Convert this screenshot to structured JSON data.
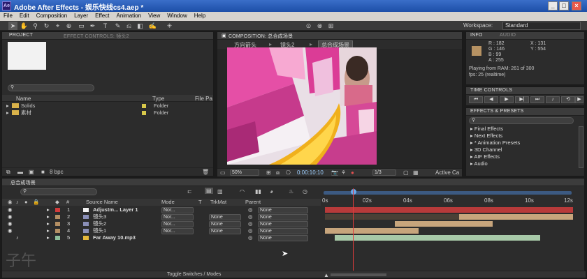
{
  "window": {
    "title": "Adobe After Effects - 娱乐快线cs4.aep *",
    "app_icon": "Ae"
  },
  "menu": [
    "File",
    "Edit",
    "Composition",
    "Layer",
    "Effect",
    "Animation",
    "View",
    "Window",
    "Help"
  ],
  "toolbar": {
    "workspace_label": "Workspace:",
    "workspace_value": "Standard"
  },
  "project": {
    "tabs": [
      "PROJECT",
      "EFFECT CONTROLS: 镜头2"
    ],
    "columns": {
      "name": "Name",
      "type": "Type",
      "filepath": "File Pa"
    },
    "items": [
      {
        "name": "Solids",
        "type": "Folder"
      },
      {
        "name": "素材",
        "type": "Folder"
      }
    ],
    "bpc": "8 bpc"
  },
  "composition": {
    "tab": "COMPOSITION: 总合成场景",
    "breadcrumbs": [
      "方向箭头",
      "镜头2",
      "总合成场景"
    ],
    "zoom": "50%",
    "timecode": "0:00:10:10",
    "resolution": "1/3",
    "camera": "Active Ca"
  },
  "info": {
    "tabs": [
      "INFO",
      "AUDIO"
    ],
    "r": "R : 182",
    "g": "G : 146",
    "b": "B : 99",
    "a": "A : 255",
    "x": "X : 131",
    "y": "Y : 554",
    "playing": "Playing from RAM: 261 of 300",
    "fps": "fps: 25 (realtime)",
    "color": "#b69263"
  },
  "time_controls": {
    "tab": "TIME CONTROLS"
  },
  "effects": {
    "tab": "EFFECTS & PRESETS",
    "items": [
      "Final Effects",
      "Next Effects",
      "* Animation Presets",
      "3D Channel",
      "AIF Effects",
      "Audio"
    ]
  },
  "timeline": {
    "tab": "总合成场景",
    "columns": {
      "num": "#",
      "source": "Source Name",
      "mode": "Mode",
      "t": "T",
      "trkmat": "TrkMat",
      "parent": "Parent"
    },
    "ruler": [
      "0s",
      "02s",
      "04s",
      "06s",
      "08s",
      "10s",
      "12s"
    ],
    "layers": [
      {
        "num": "1",
        "name": "Adjustm... Layer 1",
        "mode": "Nor...",
        "trkmat": "",
        "parent": "None",
        "label": "#e6e6e6"
      },
      {
        "num": "2",
        "name": "镜头3",
        "mode": "Nor...",
        "trkmat": "None",
        "parent": "None",
        "label": "#b48f63"
      },
      {
        "num": "3",
        "name": "镜头2",
        "mode": "Nor...",
        "trkmat": "None",
        "parent": "None",
        "label": "#b48f63"
      },
      {
        "num": "4",
        "name": "镜头1",
        "mode": "Nor...",
        "trkmat": "None",
        "parent": "None",
        "label": "#b48f63"
      },
      {
        "num": "5",
        "name": "Far Away 10.mp3",
        "mode": "",
        "trkmat": "",
        "parent": "None",
        "label": "#8fbf9b"
      }
    ],
    "toggle_label": "Toggle Switches / Modes"
  },
  "watermark": "子午"
}
